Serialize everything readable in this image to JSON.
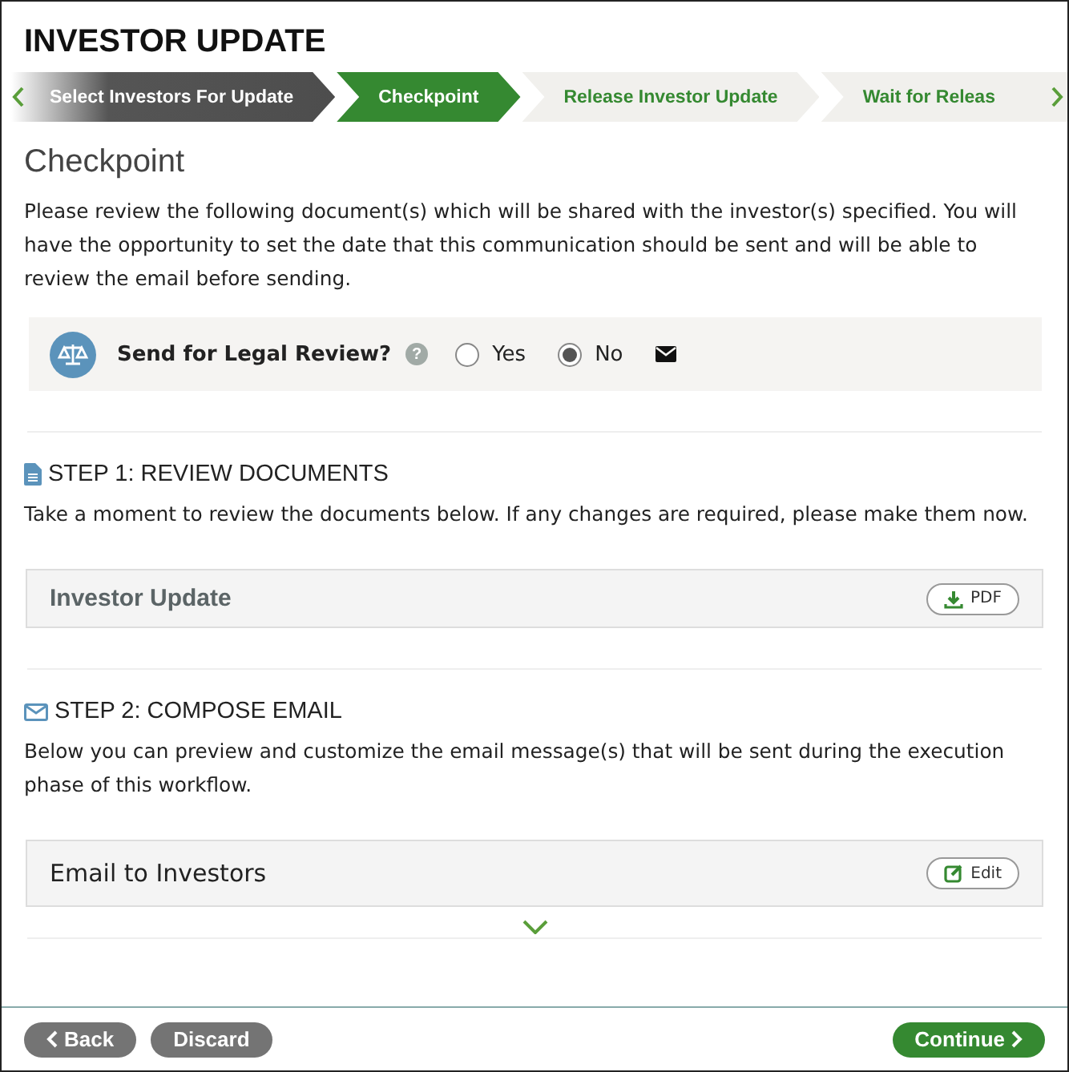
{
  "page_title": "INVESTOR UPDATE",
  "steps": [
    {
      "label": "Select Investors For Update",
      "kind": "done"
    },
    {
      "label": "Checkpoint",
      "kind": "current"
    },
    {
      "label": "Release Investor Update",
      "kind": "upcoming"
    },
    {
      "label": "Wait for Releas",
      "kind": "upcoming"
    }
  ],
  "heading": "Checkpoint",
  "intro": "Please review the following document(s) which will be shared with the investor(s) specified. You will have the opportunity to set the date that this communication should be sent and will be able to review the email before sending.",
  "legal_review": {
    "label": "Send for Legal Review?",
    "help": "?",
    "options": [
      {
        "label": "Yes",
        "selected": false
      },
      {
        "label": "No",
        "selected": true
      }
    ]
  },
  "sections": [
    {
      "kind": "documents",
      "title": "STEP 1: REVIEW DOCUMENTS",
      "text": "Take a moment to review the documents below. If any changes are required, please make them now.",
      "item": {
        "title": "Investor Update",
        "action": "PDF"
      }
    },
    {
      "kind": "email",
      "title": "STEP 2: COMPOSE EMAIL",
      "text": "Below you can preview and customize the email message(s) that will be sent during the execution phase of this workflow.",
      "item": {
        "title": "Email to Investors",
        "action": "Edit"
      }
    }
  ],
  "footer": {
    "back": "Back",
    "discard": "Discard",
    "continue": "Continue"
  }
}
